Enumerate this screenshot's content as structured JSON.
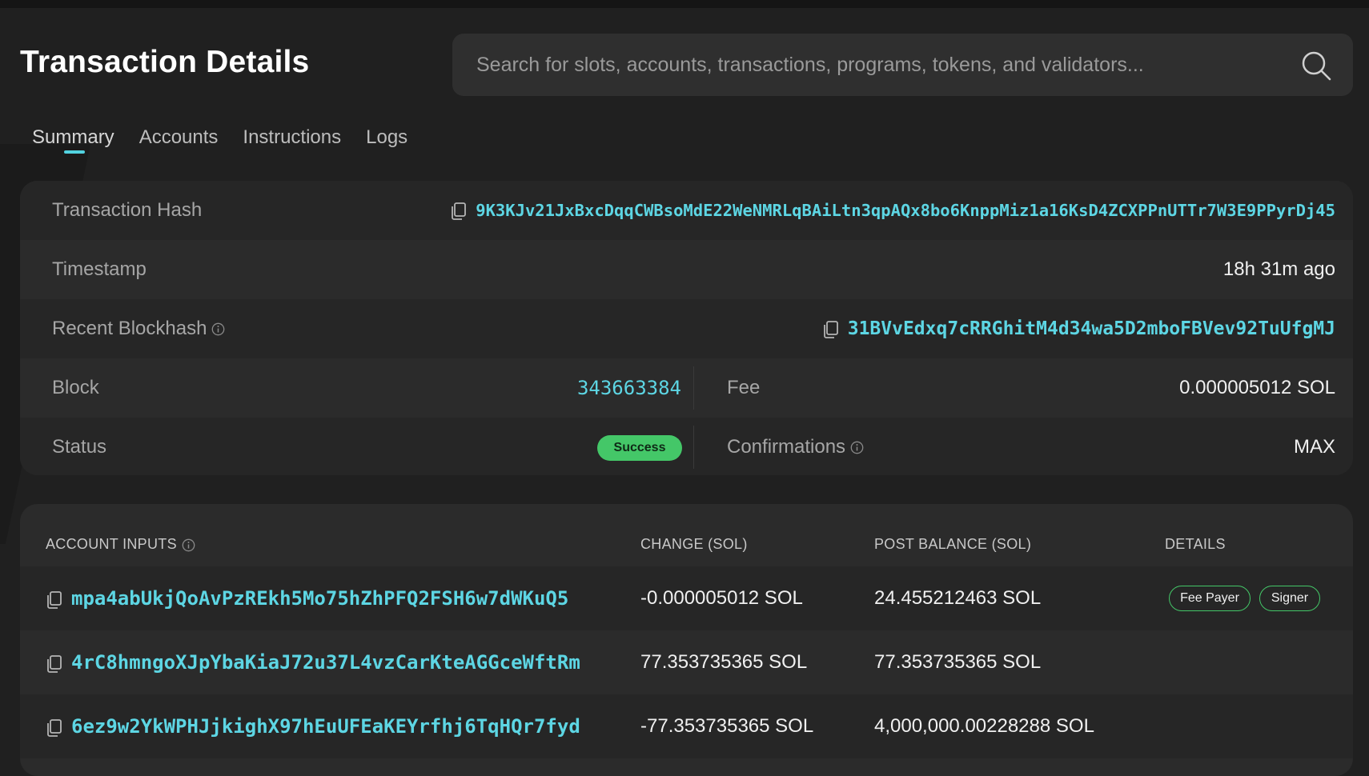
{
  "header": {
    "title": "Transaction Details",
    "search_placeholder": "Search for slots, accounts, transactions, programs, tokens, and validators..."
  },
  "tabs": [
    {
      "label": "Summary",
      "active": true
    },
    {
      "label": "Accounts",
      "active": false
    },
    {
      "label": "Instructions",
      "active": false
    },
    {
      "label": "Logs",
      "active": false
    }
  ],
  "summary": {
    "hash_label": "Transaction Hash",
    "hash_value": "9K3KJv21JxBxcDqqCWBsoMdE22WeNMRLqBAiLtn3qpAQx8bo6KnppMiz1a16KsD4ZCXPPnUTTr7W3E9PPyrDj45",
    "timestamp_label": "Timestamp",
    "timestamp_value": "18h 31m ago",
    "blockhash_label": "Recent Blockhash",
    "blockhash_value": "31BVvEdxq7cRRGhitM4d34wa5D2mboFBVev92TuUfgMJ",
    "block_label": "Block",
    "block_value": "343663384",
    "fee_label": "Fee",
    "fee_value": "0.000005012 SOL",
    "status_label": "Status",
    "status_value": "Success",
    "confirmations_label": "Confirmations",
    "confirmations_value": "MAX"
  },
  "accounts": {
    "headers": [
      "ACCOUNT INPUTS",
      "CHANGE (SOL)",
      "POST BALANCE (SOL)",
      "DETAILS"
    ],
    "rows": [
      {
        "account": "mpa4abUkjQoAvPzREkh5Mo75hZhPFQ2FSH6w7dWKuQ5",
        "change": "-0.000005012 SOL",
        "post_balance": "24.455212463 SOL",
        "tags": [
          "Fee Payer",
          "Signer"
        ]
      },
      {
        "account": "4rC8hmngoXJpYbaKiaJ72u37L4vzCarKteAGGceWftRm",
        "change": "77.353735365 SOL",
        "post_balance": "77.353735365 SOL",
        "tags": []
      },
      {
        "account": "6ez9w2YkWPHJjkighX97hEuUFEaKEYrfhj6TqHQr7fyd",
        "change": "-77.353735365 SOL",
        "post_balance": "4,000,000.00228288 SOL",
        "tags": []
      }
    ]
  },
  "colors": {
    "accent": "#5dd6e4",
    "success": "#44c768",
    "background": "#202020",
    "card": "#2b2b2b"
  }
}
